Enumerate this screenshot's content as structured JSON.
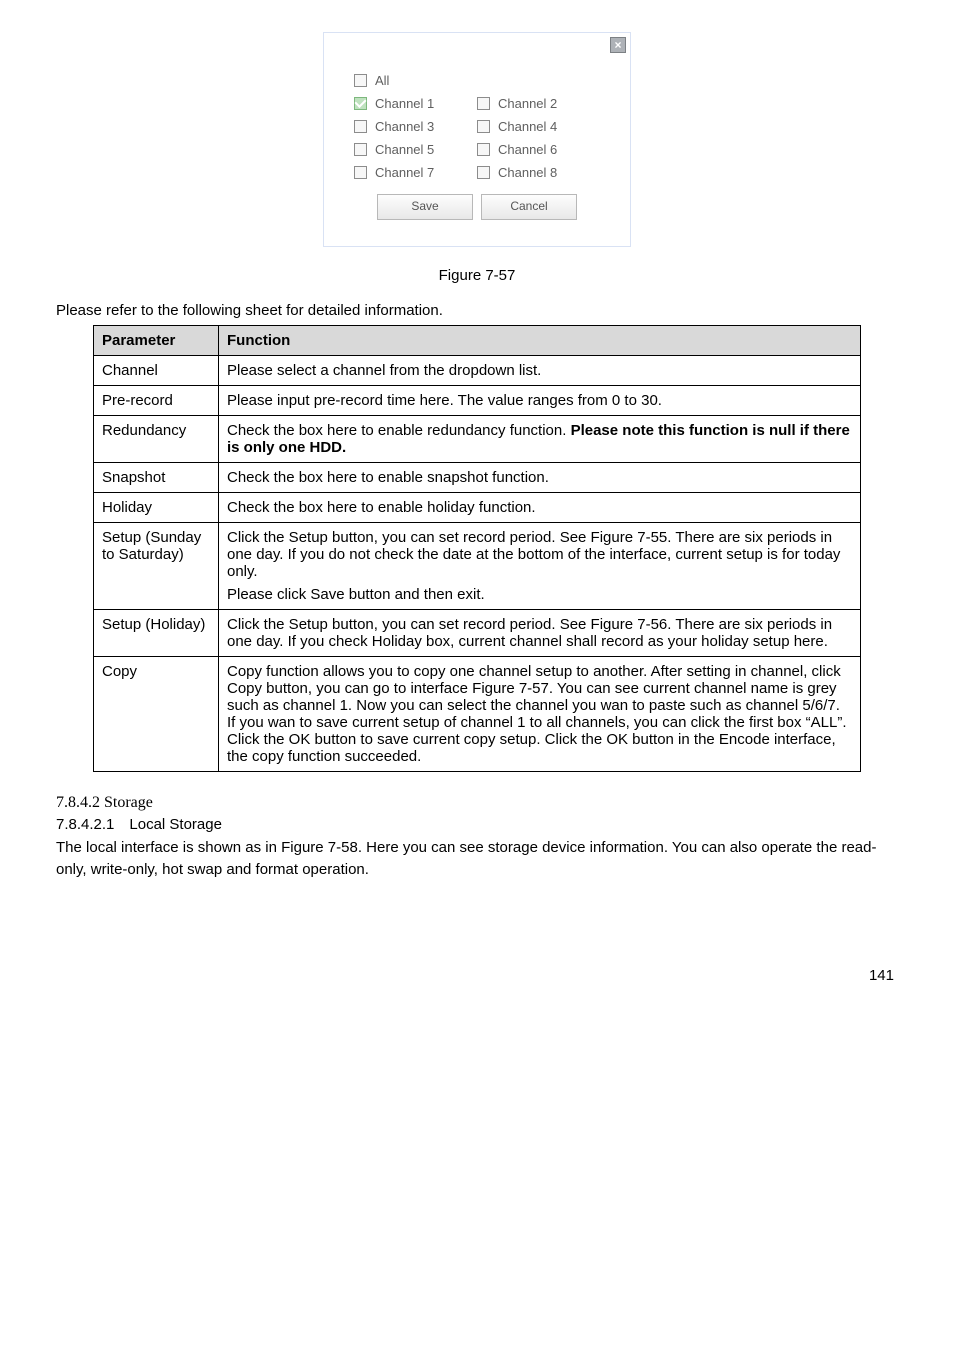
{
  "dialog": {
    "close_glyph": "×",
    "all_label": "All",
    "channels": [
      {
        "left_label": "Channel 1",
        "left_checked": true,
        "right_label": "Channel 2"
      },
      {
        "left_label": "Channel 3",
        "right_label": "Channel 4"
      },
      {
        "left_label": "Channel 5",
        "right_label": "Channel 6"
      },
      {
        "left_label": "Channel 7",
        "right_label": "Channel 8"
      }
    ],
    "save_label": "Save",
    "cancel_label": "Cancel"
  },
  "figure_caption": "Figure 7-57",
  "lead_in": "Please refer to the following sheet for detailed information.",
  "table": {
    "head_param": "Parameter",
    "head_func": "Function",
    "rows": [
      {
        "param": "Channel",
        "func": "Please select a channel from the dropdown list."
      },
      {
        "param": "Pre-record",
        "func": "Please input pre-record time here. The value ranges from 0 to 30."
      },
      {
        "param": "Redundancy",
        "func_prefix": "Check the box here to enable redundancy function. ",
        "func_bold": "Please note this function is null if there is only one HDD."
      },
      {
        "param": "Snapshot",
        "func": "Check the box here to enable snapshot function."
      },
      {
        "param": "Holiday",
        "func": "Check the box here to enable holiday function."
      },
      {
        "param": "Setup (Sunday to Saturday)",
        "func": "Click the Setup button, you can set record period. See Figure 7-55. There are six periods in one day. If you do not check the date at the bottom of the interface, current setup is for today only.",
        "func_extra": "Please click Save button and then exit."
      },
      {
        "param": "Setup (Holiday)",
        "func": "Click the Setup button, you can set record period. See Figure 7-56. There are six periods in one day. If you check Holiday box, current channel shall record as your holiday setup here."
      },
      {
        "param": "Copy",
        "func": "Copy function allows you to copy one channel setup to another. After setting in channel, click Copy button, you can go to interface Figure 7-57. You can see current channel name is grey such as channel 1. Now you can select the channel you wan to paste such as channel 5/6/7. If you wan to save current setup of channel 1 to all channels, you can click the first box “ALL”. Click the OK button to save current copy setup. Click the OK button in the Encode interface, the copy function succeeded."
      }
    ]
  },
  "section": {
    "num": "7.8.4.2 Storage",
    "sub": "7.8.4.2.1 Local Storage",
    "body": "The local interface is shown as in Figure 7-58. Here you can see storage device information. You can also operate the read-only, write-only, hot swap and format operation."
  },
  "page_number": "141"
}
